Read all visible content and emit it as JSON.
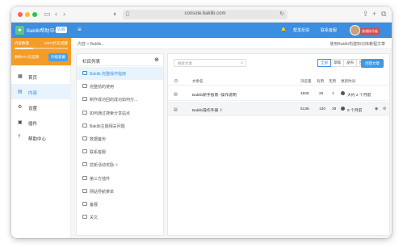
{
  "browser": {
    "url": "console.baklib.com"
  },
  "sidebar": {
    "brand_name": "Baklib帮助中心",
    "version_badge": "V.99",
    "promo": {
      "line1_left": "内容数量",
      "line1_right": "2/672历史提醒",
      "progress": 0.35,
      "line2": "剩余271天延期",
      "upgrade_label": "升级套餐"
    },
    "nav": [
      {
        "icon": "grid-icon",
        "glyph": "▦",
        "label": "首页"
      },
      {
        "icon": "document-icon",
        "glyph": "▤",
        "label": "内容"
      },
      {
        "icon": "gear-icon",
        "glyph": "⚙",
        "label": "设置"
      },
      {
        "icon": "plugin-icon",
        "glyph": "▣",
        "label": "插件"
      },
      {
        "icon": "help-icon",
        "glyph": "?",
        "label": "帮助中心"
      }
    ],
    "active_index": 1
  },
  "topbar": {
    "links": [
      "帮发反馈",
      "联系客服"
    ],
    "vip_badge": "普通账号级"
  },
  "breadcrumb": {
    "path": "内容 > Baklib...",
    "help_link": "使用Baklib构建知识库教程文章"
  },
  "folders": {
    "title": "栏目列表",
    "items": [
      "Baklib 完整操作指南",
      "完整前的使用",
      "制作成功回的成功如何分...",
      "如何通过搜索分享站点",
      "Baklib主题相关问题",
      "数据备份",
      "联系客服",
      "抗新活动奖励 ✌",
      "第三方插件",
      "网站导航菜单",
      "备展",
      "关文"
    ],
    "active_index": 0
  },
  "docs": {
    "search_placeholder": "搜索文章",
    "filters": [
      "全部",
      "草稿",
      "发布",
      "回收站"
    ],
    "active_filter": 0,
    "new_button": "创建文章",
    "columns": [
      "文章名",
      "浏览量",
      "有用",
      "无用",
      "更新时间"
    ],
    "rows": [
      {
        "title": "Baklib新手指南--操作说明",
        "views": "4606",
        "useful": "25",
        "useless": "1",
        "updated": "大约 2 个月前",
        "status_color": "#555555"
      },
      {
        "title": "Baklib操作手册 ✌",
        "views": "6136",
        "useful": "130",
        "useless": "29",
        "updated": "6 个月前",
        "status_color": "#555555"
      }
    ]
  }
}
